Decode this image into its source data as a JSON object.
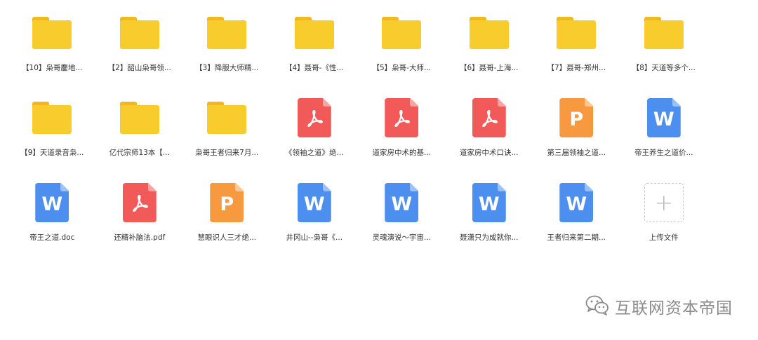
{
  "colors": {
    "folder": "#f9cc2e",
    "folder_tab": "#f0b81e",
    "word": "#4c8fef",
    "ppt": "#f79a3f",
    "pdf": "#f25a5a"
  },
  "files": [
    {
      "type": "folder",
      "icon": "folder-icon",
      "name": "【10】枭哥鏖地..."
    },
    {
      "type": "folder",
      "icon": "folder-icon",
      "name": "【2】韶山枭哥领..."
    },
    {
      "type": "folder",
      "icon": "folder-icon",
      "name": "【3】降服大师精..."
    },
    {
      "type": "folder",
      "icon": "folder-icon",
      "name": "【4】聂哥-《性..."
    },
    {
      "type": "folder",
      "icon": "folder-icon",
      "name": "【5】枭哥-大师..."
    },
    {
      "type": "folder",
      "icon": "folder-icon",
      "name": "【6】聂哥-上海..."
    },
    {
      "type": "folder",
      "icon": "folder-icon",
      "name": "【7】聂哥-郑州..."
    },
    {
      "type": "folder",
      "icon": "folder-icon",
      "name": "【8】天道等多个..."
    },
    {
      "type": "folder",
      "icon": "folder-icon",
      "name": "【9】天道录音枭..."
    },
    {
      "type": "folder",
      "icon": "folder-icon",
      "name": "亿代宗师13本【..."
    },
    {
      "type": "folder",
      "icon": "folder-icon",
      "name": "枭哥王者归来7月..."
    },
    {
      "type": "pdf",
      "icon": "pdf-file-icon",
      "name": "《领袖之道》绝..."
    },
    {
      "type": "pdf",
      "icon": "pdf-file-icon",
      "name": "道家房中术的基..."
    },
    {
      "type": "pdf",
      "icon": "pdf-file-icon",
      "name": "道家房中术口诀..."
    },
    {
      "type": "ppt",
      "icon": "ppt-file-icon",
      "letter": "P",
      "name": "第三届领袖之道..."
    },
    {
      "type": "word",
      "icon": "word-file-icon",
      "letter": "W",
      "name": "帝王养生之道价..."
    },
    {
      "type": "word",
      "icon": "word-file-icon",
      "letter": "W",
      "name": "帝王之道.doc"
    },
    {
      "type": "pdf",
      "icon": "pdf-file-icon",
      "name": "还精补脑法.pdf"
    },
    {
      "type": "ppt",
      "icon": "ppt-file-icon",
      "letter": "P",
      "name": "慧眼识人三才绝..."
    },
    {
      "type": "word",
      "icon": "word-file-icon",
      "letter": "W",
      "name": "井冈山--枭哥《..."
    },
    {
      "type": "word",
      "icon": "word-file-icon",
      "letter": "W",
      "name": "灵魂演说～宇宙..."
    },
    {
      "type": "word",
      "icon": "word-file-icon",
      "letter": "W",
      "name": "聂潇只为成就你..."
    },
    {
      "type": "word",
      "icon": "word-file-icon",
      "letter": "W",
      "name": "王者归来第二期..."
    },
    {
      "type": "upload",
      "icon": "plus-icon",
      "name": "上传文件"
    }
  ],
  "watermark": {
    "icon": "wechat-icon",
    "text": "互联网资本帝国"
  }
}
